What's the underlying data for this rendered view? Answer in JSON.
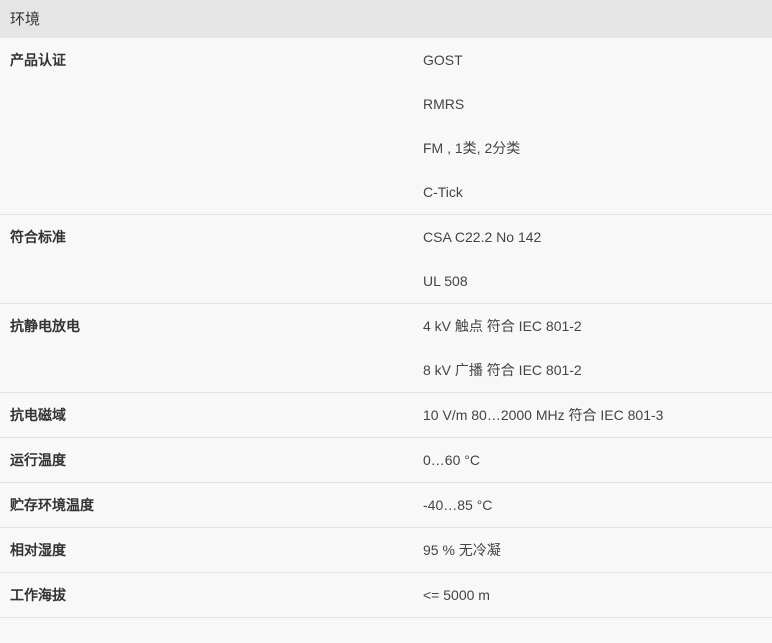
{
  "section": {
    "title": "环境"
  },
  "rows": [
    {
      "label": "产品认证",
      "values": [
        "GOST",
        "RMRS",
        "FM , 1类, 2分类",
        "C-Tick"
      ]
    },
    {
      "label": "符合标准",
      "values": [
        "CSA C22.2 No 142",
        "UL 508"
      ]
    },
    {
      "label": "抗静电放电",
      "values": [
        "4 kV 触点 符合 IEC 801-2",
        "8 kV 广播 符合 IEC 801-2"
      ]
    },
    {
      "label": "抗电磁域",
      "values": [
        "10 V/m 80…2000 MHz 符合 IEC 801-3"
      ]
    },
    {
      "label": "运行温度",
      "values": [
        "0…60 °C"
      ]
    },
    {
      "label": "贮存环境温度",
      "values": [
        "-40…85 °C"
      ]
    },
    {
      "label": "相对湿度",
      "values": [
        "95 % 无冷凝"
      ]
    },
    {
      "label": "工作海拔",
      "values": [
        "<= 5000 m"
      ]
    }
  ]
}
